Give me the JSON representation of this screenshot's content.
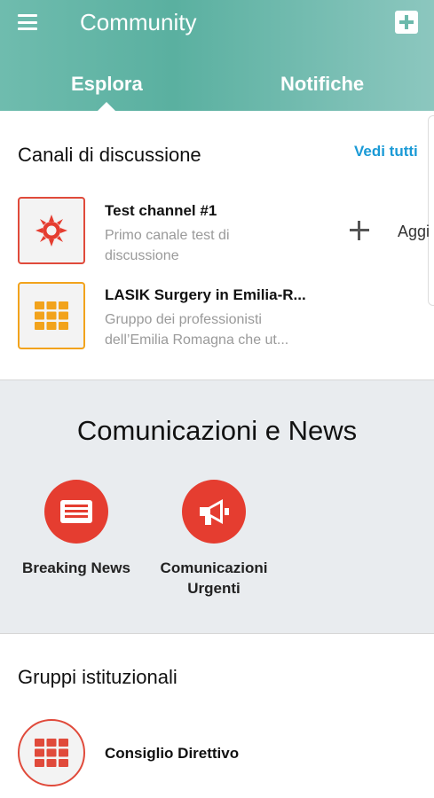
{
  "header": {
    "title": "Community",
    "tabs": [
      {
        "label": "Esplora",
        "active": true
      },
      {
        "label": "Notifiche",
        "active": false
      }
    ],
    "accent_color": "#6cb9ab"
  },
  "canali": {
    "title": "Canali di discussione",
    "see_all_label": "Vedi tutti",
    "add_label": "Aggi",
    "items": [
      {
        "title": "Test channel #1",
        "desc_line1": "Primo canale test di",
        "desc_line2": "discussione",
        "icon": "sun-icon",
        "color": "#e04a3b"
      },
      {
        "title": "LASIK Surgery in Emilia-R...",
        "desc_line1": "Gruppo dei professionisti",
        "desc_line2": "dell’Emilia Romagna che ut...",
        "icon": "grid-icon",
        "color": "#f2a31c"
      }
    ]
  },
  "news": {
    "title": "Comunicazioni e News",
    "items": [
      {
        "label_line1": "Breaking News",
        "label_line2": "",
        "icon": "newspaper-icon"
      },
      {
        "label_line1": "Comunicazioni",
        "label_line2": "Urgenti",
        "icon": "megaphone-icon"
      }
    ],
    "color": "#e53d30"
  },
  "gruppi": {
    "title": "Gruppi istituzionali",
    "items": [
      {
        "name": "Consiglio Direttivo",
        "icon": "grid-icon"
      }
    ]
  }
}
